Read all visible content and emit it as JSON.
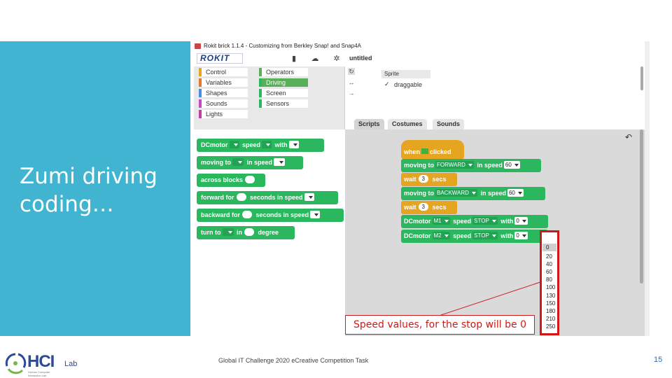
{
  "slide": {
    "title": "Zumi driving coding…",
    "footer": "Global IT Challenge 2020 eCreative Competition Task",
    "page_number": "15",
    "annotation": "Speed values, for the stop will be 0"
  },
  "logo": {
    "main": "HCI",
    "suffix": "Lab",
    "subtitle_line1": "Human Computer",
    "subtitle_line2": "Interaction Lab"
  },
  "app": {
    "window_title": "Rokit brick 1.1.4 - Customizing from Berkley Snap! and Snap4A",
    "logo_text": "ROKIT",
    "project_name": "untitled",
    "icons": {
      "file": "file-icon",
      "cloud": "cloud-icon",
      "settings": "gear-icon",
      "undo": "undo-icon"
    },
    "categories": [
      {
        "label": "Control",
        "color": "#e6a520"
      },
      {
        "label": "Operators",
        "color": "#58b058"
      },
      {
        "label": "Variables",
        "color": "#e07a2e"
      },
      {
        "label": "Driving",
        "color": "#2bb75e",
        "selected": true
      },
      {
        "label": "Shapes",
        "color": "#4a8de0"
      },
      {
        "label": "Screen",
        "color": "#2bb75e"
      },
      {
        "label": "Sounds",
        "color": "#c847c8"
      },
      {
        "label": "Sensors",
        "color": "#2bb75e"
      },
      {
        "label": "Lights",
        "color": "#c040a0"
      }
    ],
    "palette": {
      "dcmotor": {
        "a": "DCmotor",
        "b": "speed",
        "c": "with"
      },
      "moving": {
        "a": "moving to",
        "b": "in speed"
      },
      "across": {
        "a": "across blocks"
      },
      "forward": {
        "a": "forward for",
        "b": "seconds in speed"
      },
      "backward": {
        "a": "backward for",
        "b": "seconds in speed"
      },
      "turn": {
        "a": "turn to",
        "b": "in",
        "c": "degree"
      }
    },
    "sprite": {
      "name": "Sprite",
      "draggable_check": "✓",
      "draggable_label": "draggable"
    },
    "tabs": [
      "Scripts",
      "Costumes",
      "Sounds"
    ],
    "script": {
      "hat_when": "when",
      "hat_clicked": "clicked",
      "move1": {
        "a": "moving to",
        "dir": "FORWARD",
        "b": "in speed",
        "speed": "60"
      },
      "wait1": {
        "a": "wait",
        "n": "3",
        "b": "secs"
      },
      "move2": {
        "a": "moving to",
        "dir": "BACKWARD",
        "b": "in speed",
        "speed": "60"
      },
      "wait2": {
        "a": "wait",
        "n": "3",
        "b": "secs"
      },
      "dc1": {
        "a": "DCmotor",
        "motor": "M1",
        "b": "speed",
        "val": "STOP",
        "c": "with",
        "w": "0"
      },
      "dc2": {
        "a": "DCmotor",
        "motor": "M2",
        "b": "speed",
        "val": "STOP",
        "c": "with",
        "w": "0"
      }
    },
    "speed_options": [
      "0",
      "20",
      "40",
      "60",
      "80",
      "100",
      "130",
      "150",
      "180",
      "210",
      "250"
    ]
  },
  "colors": {
    "panel": "#40b4d0",
    "annotation": "#d01818",
    "looks_green": "#2bb75e",
    "control_yellow": "#e6a520"
  }
}
